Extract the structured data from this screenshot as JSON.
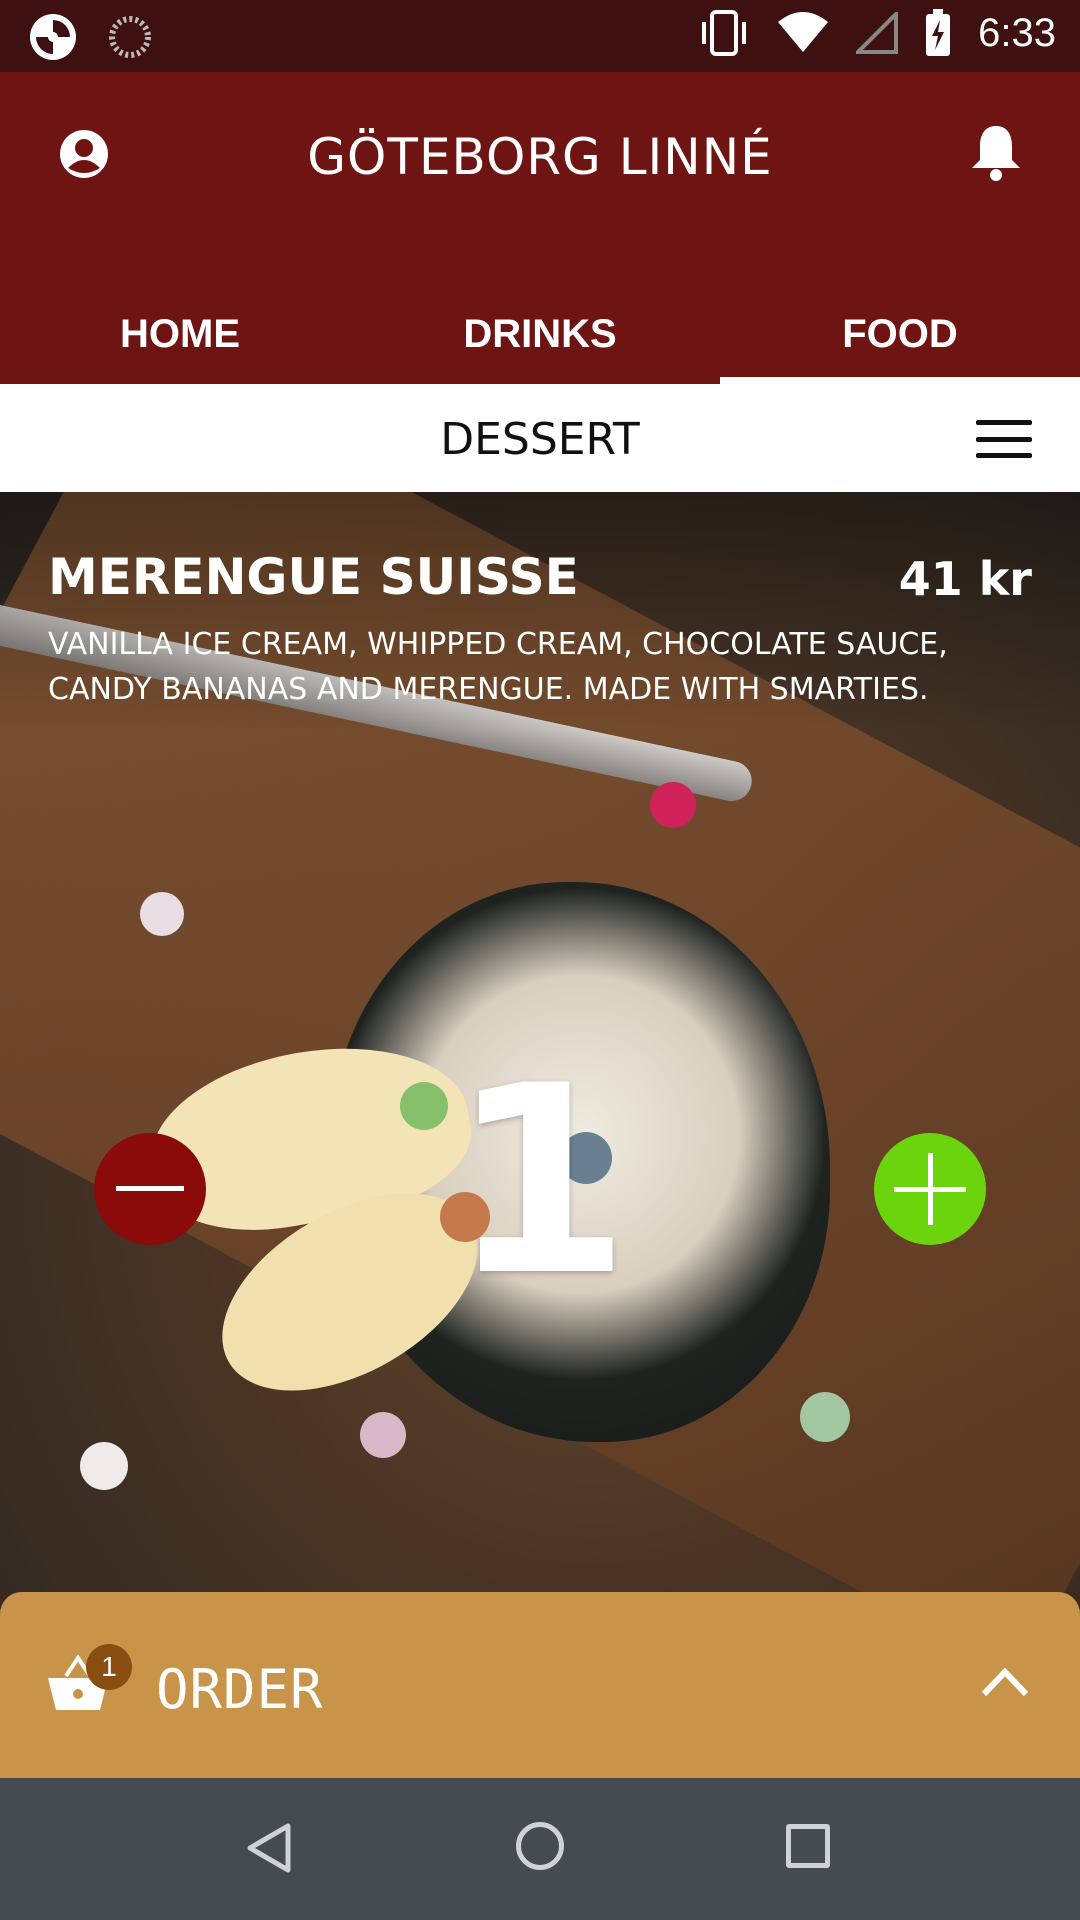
{
  "status_bar": {
    "time": "6:33",
    "icons": [
      "app-icon",
      "loading-icon",
      "vibrate-icon",
      "wifi-icon",
      "signal-icon",
      "battery-charging-icon"
    ]
  },
  "header": {
    "title": "GÖTEBORG LINNÉ",
    "left_icon": "profile-icon",
    "right_icon": "bell-icon"
  },
  "tabs": [
    {
      "label": "HOME",
      "active": false
    },
    {
      "label": "DRINKS",
      "active": false
    },
    {
      "label": "FOOD",
      "active": true
    }
  ],
  "category": {
    "title": "DESSERT",
    "menu_icon": "hamburger-menu-icon"
  },
  "item": {
    "name": "MERENGUE SUISSE",
    "price": "41 kr",
    "description": "VANILLA ICE CREAM, WHIPPED CREAM, CHOCOLATE SAUCE, CANDY BANANAS AND MERENGUE. MADE WITH SMARTIES.",
    "quantity": "1",
    "minus_color": "#8b0a0a",
    "plus_color": "#6bd40c"
  },
  "order_bar": {
    "label": "ORDER",
    "basket_count": "1",
    "background": "#c8944a"
  },
  "nav_bar": {
    "icons": [
      "back-icon",
      "home-icon",
      "recents-icon"
    ]
  }
}
